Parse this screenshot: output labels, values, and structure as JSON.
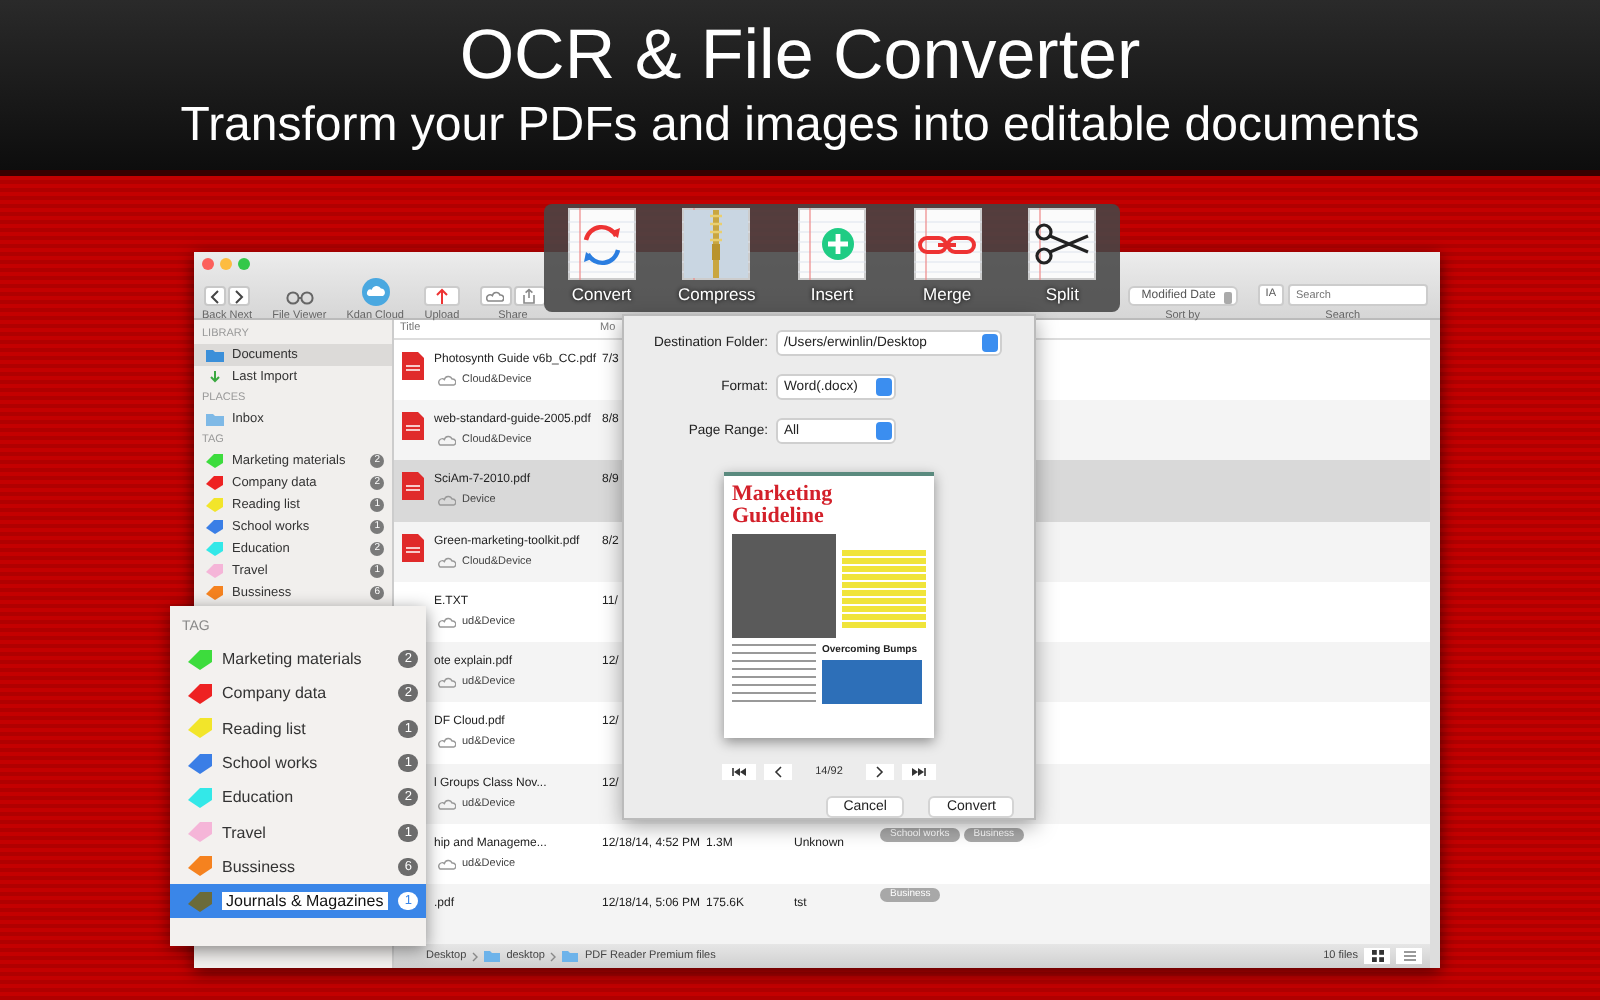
{
  "header": {
    "title": "OCR & File Converter",
    "subtitle": "Transform your PDFs and images into editable documents"
  },
  "toolbar": [
    {
      "kind": "nav",
      "label": "Back Next"
    },
    {
      "kind": "viewer",
      "label": "File Viewer"
    },
    {
      "kind": "cloud",
      "label": "Kdan Cloud"
    },
    {
      "kind": "upload",
      "label": "Upload"
    },
    {
      "kind": "share",
      "label": "Share"
    },
    {
      "kind": "sort",
      "value": "Modified Date",
      "label": "Sort by"
    },
    {
      "kind": "search",
      "scope": "IA",
      "placeholder": "Search",
      "label": "Search"
    }
  ],
  "tools": [
    {
      "kind": "convert",
      "label": "Convert"
    },
    {
      "kind": "compress",
      "label": "Compress"
    },
    {
      "kind": "insert",
      "label": "Insert"
    },
    {
      "kind": "merge",
      "label": "Merge"
    },
    {
      "kind": "split",
      "label": "Split"
    }
  ],
  "sidebar": {
    "sections": [
      {
        "heading": "LIBRARY",
        "items": [
          {
            "kind": "documents",
            "label": "Documents",
            "selected": true
          },
          {
            "kind": "import",
            "label": "Last Import",
            "selected": false
          }
        ]
      },
      {
        "heading": "PLACES",
        "items": [
          {
            "kind": "inbox",
            "label": "Inbox",
            "selected": false
          }
        ]
      }
    ],
    "tag_heading": "TAG",
    "tags": [
      {
        "label": "Marketing materials",
        "color": "#3ddc3d",
        "count": "2"
      },
      {
        "label": "Company data",
        "color": "#ee2222",
        "count": "2"
      },
      {
        "label": "Reading list",
        "color": "#f2e52a",
        "count": "1"
      },
      {
        "label": "School works",
        "color": "#3a7ee6",
        "count": "1"
      },
      {
        "label": "Education",
        "color": "#33e8e8",
        "count": "2"
      },
      {
        "label": "Travel",
        "color": "#f5b5d8",
        "count": "1"
      },
      {
        "label": "Bussiness",
        "color": "#f5821f",
        "count": "6"
      }
    ]
  },
  "table": {
    "columns": [
      "Title",
      "Mo"
    ],
    "rows": [
      {
        "kind": "pdf",
        "name": "Photosynth Guide v6b_CC.pdf",
        "date": "7/3",
        "storage": "Cloud&Device",
        "selected": false
      },
      {
        "kind": "pdf",
        "name": "web-standard-guide-2005.pdf",
        "date": "8/8",
        "storage": "Cloud&Device",
        "selected": false
      },
      {
        "kind": "pdf",
        "name": "SciAm-7-2010.pdf",
        "date": "8/9",
        "storage": "Device",
        "selected": true
      },
      {
        "kind": "pdf",
        "name": "Green-marketing-toolkit.pdf",
        "date": "8/2",
        "storage": "Cloud&Device",
        "selected": false
      },
      {
        "name": "E.TXT",
        "date": "11/",
        "storage": "ud&Device",
        "selected": false
      },
      {
        "name": "ote explain.pdf",
        "date": "12/",
        "storage": "ud&Device",
        "selected": false
      },
      {
        "name": "DF Cloud.pdf",
        "date": "12/",
        "storage": "ud&Device",
        "selected": false
      },
      {
        "name": "l Groups Class Nov...",
        "date": "12/",
        "storage": "ud&Device",
        "selected": false
      },
      {
        "name": "hip and Manageme...",
        "date": "12/18/14, 4:52 PM",
        "size": "1.3M",
        "location": "Unknown",
        "storage": "ud&Device",
        "tags": [
          "School works",
          "Business"
        ],
        "selected": false
      },
      {
        "name": ".pdf",
        "date": "12/18/14, 5:06 PM",
        "size": "175.6K",
        "location": "tst",
        "tags": [
          "Business"
        ],
        "selected": false
      }
    ]
  },
  "status_bar": {
    "path": [
      "Desktop",
      "desktop",
      "PDF Reader Premium files"
    ],
    "count": "10 files"
  },
  "dialog": {
    "fields": [
      {
        "kind": "path",
        "label": "Destination Folder:",
        "value": "/Users/erwinlin/Desktop"
      },
      {
        "kind": "short",
        "label": "Format:",
        "value": "Word(.docx)"
      },
      {
        "kind": "short",
        "label": "Page Range:",
        "value": "All"
      }
    ],
    "preview": {
      "title": "Marketing Guideline",
      "headline": "Overcoming Bumps"
    },
    "page": "14/92",
    "buttons": [
      "Cancel",
      "Convert"
    ]
  },
  "tag_popup": {
    "heading": "TAG",
    "tags": [
      {
        "label": "Marketing materials",
        "color": "#3ddc3d",
        "count": "2",
        "selected": false
      },
      {
        "label": "Company data",
        "color": "#ee2222",
        "count": "2",
        "selected": false
      },
      {
        "label": "Reading list",
        "color": "#f2e52a",
        "count": "1",
        "selected": false
      },
      {
        "label": "School works",
        "color": "#3a7ee6",
        "count": "1",
        "selected": false
      },
      {
        "label": "Education",
        "color": "#33e8e8",
        "count": "2",
        "selected": false
      },
      {
        "label": "Travel",
        "color": "#f5b5d8",
        "count": "1",
        "selected": false
      },
      {
        "label": "Bussiness",
        "color": "#f5821f",
        "count": "6",
        "selected": false
      },
      {
        "label": "Journals & Magazines",
        "color": "#6b6b3a",
        "count": "1",
        "selected": true
      }
    ]
  }
}
